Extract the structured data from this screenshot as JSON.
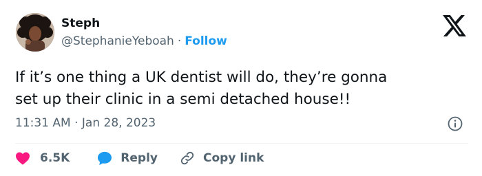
{
  "author": {
    "name": "Steph",
    "handle": "@StephanieYeboah",
    "separator": "·",
    "follow_label": "Follow"
  },
  "tweet": {
    "text": "If it’s one thing a UK dentist will do, they’re gonna\nset up their clinic in a semi detached house!!",
    "timestamp": "11:31 AM · Jan 28, 2023"
  },
  "actions": {
    "like_count": "6.5K",
    "reply_label": "Reply",
    "copy_link_label": "Copy link"
  },
  "colors": {
    "accent": "#1d9bf0",
    "like": "#f91880",
    "secondary_text": "#536471",
    "primary_text": "#0f1419"
  },
  "icons": {
    "brand": "x-logo-icon",
    "info": "info-icon",
    "like": "heart-icon",
    "reply": "speech-bubble-icon",
    "copy": "link-icon"
  }
}
